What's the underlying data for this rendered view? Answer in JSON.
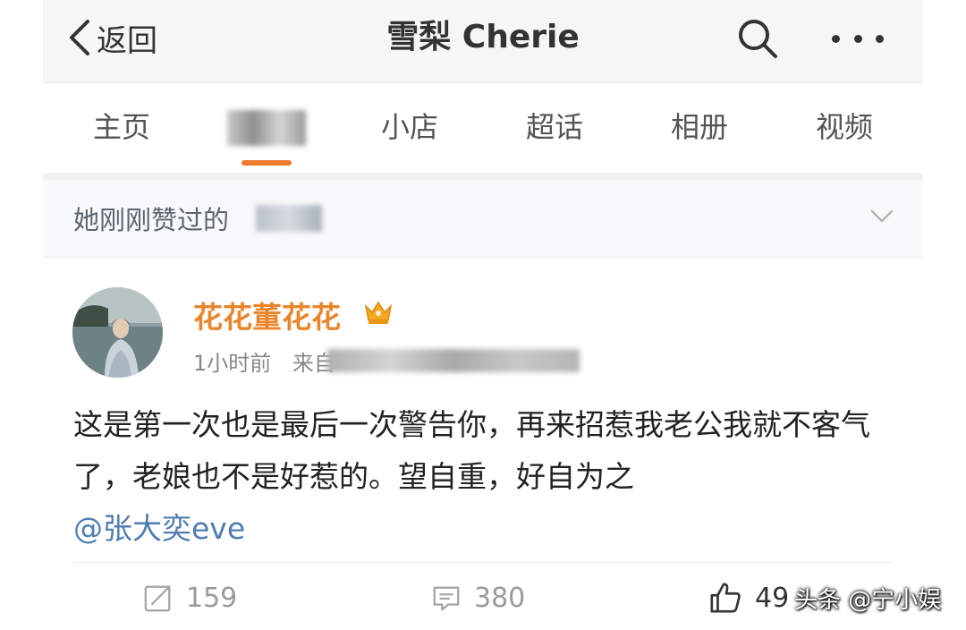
{
  "nav": {
    "back_label": "返回",
    "title": "雪梨 Cherie"
  },
  "tabs": [
    "主页",
    "小店",
    "超话",
    "相册",
    "视频"
  ],
  "liked_bar": {
    "text": "她刚刚赞过的"
  },
  "post": {
    "author": "花花董花花",
    "time": "1小时前",
    "source_prefix": "来自",
    "content": "这是第一次也是最后一次警告你，再来招惹我老公我就不客气了，老娘也不是好惹的。望自重，好自为之",
    "mention": "@张大奕eve",
    "reposts": "159",
    "comments": "380",
    "likes": "49"
  },
  "watermark": "头条 @宁小娱",
  "colors": {
    "accent": "#f07b2f",
    "author": "#e8862b",
    "link": "#4f7db0"
  }
}
